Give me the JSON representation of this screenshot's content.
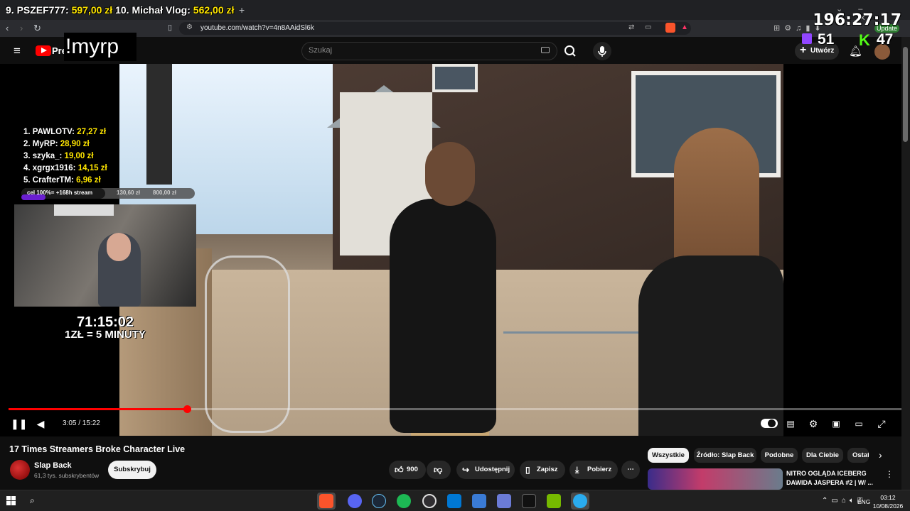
{
  "browser": {
    "url": "youtube.com/watch?v=4n8AAidSl6k",
    "new_tab": "+",
    "update_label": "Update"
  },
  "overlays": {
    "donation_ticker": [
      {
        "label": "9. PSZEF777: ",
        "amount": "597,00 zł"
      },
      {
        "label": " 10. Michał Vlog: ",
        "amount": "562,00 zł"
      }
    ],
    "stream_timer": "196:27:17",
    "twitch_viewers": "51",
    "kick_viewers": "47",
    "chat_command": "!myrp",
    "leaderboard": [
      {
        "rank_name": "1. PAWLOTV: ",
        "amount": "27,27 zł"
      },
      {
        "rank_name": "2. MyRP: ",
        "amount": "28,90 zł"
      },
      {
        "rank_name": "3. szyka_: ",
        "amount": "19,00 zł"
      },
      {
        "rank_name": "4. xgrgx1916: ",
        "amount": "14,15 zł"
      },
      {
        "rank_name": "5. CrafterTM: ",
        "amount": "6,96 zł"
      }
    ],
    "goal": {
      "label": "cel 100%= +168h stream",
      "current": "130,60 zł",
      "target": "800,00 zł",
      "progress": 0.163
    },
    "subathon_timer": "71:15:02",
    "subathon_rate": "1ZŁ = 5 MINUTY"
  },
  "youtube": {
    "logo_text": "Pre",
    "search_placeholder": "Szukaj",
    "create_label": "Utwórz",
    "player": {
      "current_time": "3:05",
      "duration": "15:22",
      "time_display": "3:05 / 15:22",
      "progress": 0.2
    },
    "video": {
      "title": "17 Times Streamers Broke Character Live",
      "channel": "Slap Back",
      "subscribers": "61,3 tys. subskrybentów",
      "subscribe_label": "Subskrybuj",
      "likes": "900",
      "share_label": "Udostępnij",
      "save_label": "Zapisz",
      "download_label": "Pobierz"
    },
    "chips": [
      "Wszystkie",
      "Źródło: Slap Back",
      "Podobne",
      "Dla Ciebie",
      "Ostatnio"
    ],
    "recommended": {
      "title": "NITRO OGLĄDA ICEBERG DAWIDA JASPERA #2 | W/ ..."
    }
  },
  "taskbar": {
    "language": "ENG",
    "time": "03:12",
    "date": "10/08/2026"
  },
  "colors": {
    "accent_red": "#ff0000",
    "donation_yellow": "#ffe600",
    "twitch_purple": "#9146ff",
    "kick_green": "#53fc18"
  }
}
